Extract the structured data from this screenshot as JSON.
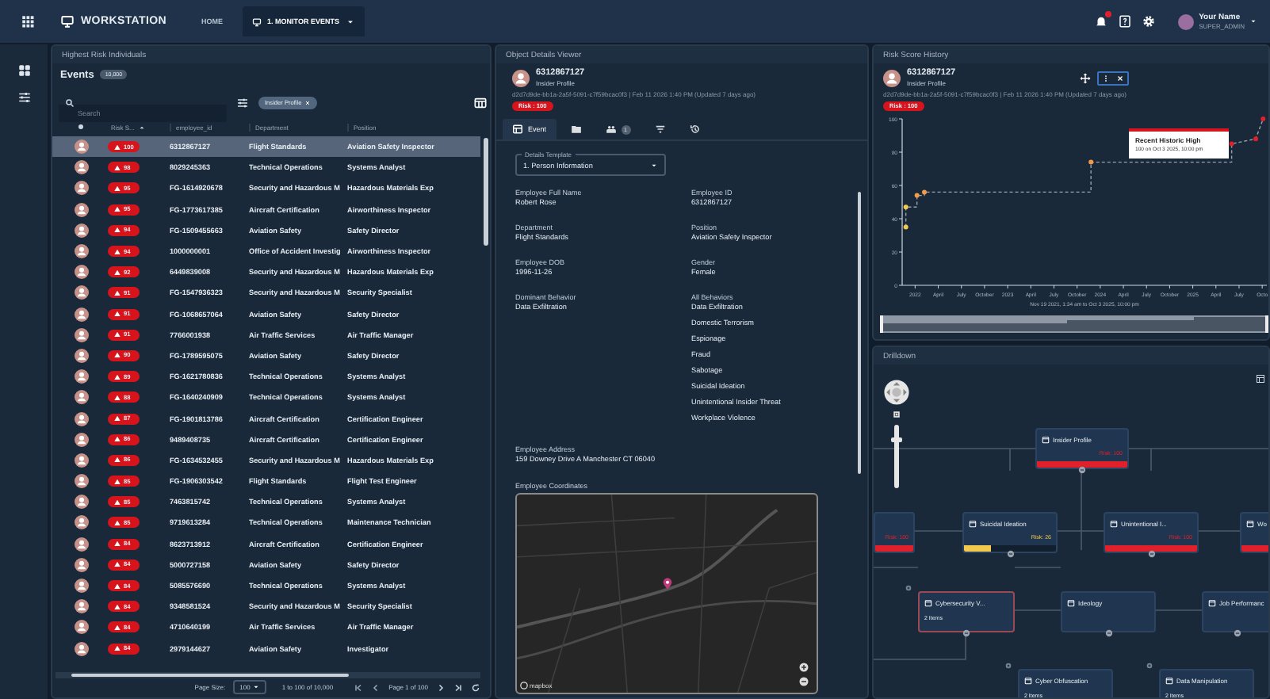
{
  "top_bar": {
    "app_title": "WORKSTATION",
    "nav": [
      {
        "label": "HOME",
        "selected": false
      },
      {
        "label": "1. MONITOR EVENTS",
        "selected": true
      }
    ],
    "user": {
      "name": "Your Name",
      "role": "SUPER_ADMIN"
    }
  },
  "events_panel": {
    "title": "Highest Risk Individuals",
    "heading": "Events",
    "count": "10,000",
    "search": {
      "placeholder": "Search"
    },
    "filters": [
      {
        "label": "Insider Profile"
      }
    ],
    "columns": [
      {
        "label": "Risk S...",
        "sorted": true
      },
      {
        "label": "employee_id",
        "sorted": false
      },
      {
        "label": "Department",
        "sorted": false
      },
      {
        "label": "Position",
        "sorted": false
      }
    ],
    "rows": [
      {
        "risk": "100",
        "employee_id": "6312867127",
        "department": "Flight Standards",
        "position": "Aviation Safety Inspector",
        "selected": true
      },
      {
        "risk": "98",
        "employee_id": "8029245363",
        "department": "Technical Operations",
        "position": "Systems Analyst",
        "selected": false
      },
      {
        "risk": "95",
        "employee_id": "FG-1614920678",
        "department": "Security and Hazardous M",
        "position": "Hazardous Materials Exp",
        "selected": false
      },
      {
        "risk": "95",
        "employee_id": "FG-1773617385",
        "department": "Aircraft Certification",
        "position": "Airworthiness Inspector",
        "selected": false
      },
      {
        "risk": "94",
        "employee_id": "FG-1509455663",
        "department": "Aviation Safety",
        "position": "Safety Director",
        "selected": false
      },
      {
        "risk": "94",
        "employee_id": "1000000001",
        "department": "Office of Accident Investig",
        "position": "Airworthiness Inspector",
        "selected": false
      },
      {
        "risk": "92",
        "employee_id": "6449839008",
        "department": "Security and Hazardous M",
        "position": "Hazardous Materials Exp",
        "selected": false
      },
      {
        "risk": "91",
        "employee_id": "FG-1547936323",
        "department": "Security and Hazardous M",
        "position": "Security Specialist",
        "selected": false
      },
      {
        "risk": "91",
        "employee_id": "FG-1068657064",
        "department": "Aviation Safety",
        "position": "Safety Director",
        "selected": false
      },
      {
        "risk": "91",
        "employee_id": "7766001938",
        "department": "Air Traffic Services",
        "position": "Air Traffic Manager",
        "selected": false
      },
      {
        "risk": "90",
        "employee_id": "FG-1789595075",
        "department": "Aviation Safety",
        "position": "Safety Director",
        "selected": false
      },
      {
        "risk": "89",
        "employee_id": "FG-1621780836",
        "department": "Technical Operations",
        "position": "Systems Analyst",
        "selected": false
      },
      {
        "risk": "88",
        "employee_id": "FG-1640240909",
        "department": "Technical Operations",
        "position": "Systems Analyst",
        "selected": false
      },
      {
        "risk": "87",
        "employee_id": "FG-1901813786",
        "department": "Aircraft Certification",
        "position": "Certification Engineer",
        "selected": false
      },
      {
        "risk": "86",
        "employee_id": "9489408735",
        "department": "Aircraft Certification",
        "position": "Certification Engineer",
        "selected": false
      },
      {
        "risk": "86",
        "employee_id": "FG-1634532455",
        "department": "Security and Hazardous M",
        "position": "Hazardous Materials Exp",
        "selected": false
      },
      {
        "risk": "85",
        "employee_id": "FG-1906303542",
        "department": "Flight Standards",
        "position": "Flight Test Engineer",
        "selected": false
      },
      {
        "risk": "85",
        "employee_id": "7463815742",
        "department": "Technical Operations",
        "position": "Systems Analyst",
        "selected": false
      },
      {
        "risk": "85",
        "employee_id": "9719613284",
        "department": "Technical Operations",
        "position": "Maintenance Technician",
        "selected": false
      },
      {
        "risk": "84",
        "employee_id": "8623713912",
        "department": "Aircraft Certification",
        "position": "Certification Engineer",
        "selected": false
      },
      {
        "risk": "84",
        "employee_id": "5000727158",
        "department": "Aviation Safety",
        "position": "Safety Director",
        "selected": false
      },
      {
        "risk": "84",
        "employee_id": "5085576690",
        "department": "Technical Operations",
        "position": "Systems Analyst",
        "selected": false
      },
      {
        "risk": "84",
        "employee_id": "9348581524",
        "department": "Security and Hazardous M",
        "position": "Security Specialist",
        "selected": false
      },
      {
        "risk": "84",
        "employee_id": "4710640199",
        "department": "Air Traffic Services",
        "position": "Air Traffic Manager",
        "selected": false
      },
      {
        "risk": "84",
        "employee_id": "2979144627",
        "department": "Aviation Safety",
        "position": "Investigator",
        "selected": false
      }
    ],
    "pagination": {
      "page_size_label": "Page Size:",
      "page_size": "100",
      "range": "1 to 100 of 10,000",
      "page": "Page 1 of 100"
    }
  },
  "details_panel": {
    "title": "Object Details Viewer",
    "record": {
      "id": "6312867127",
      "type": "Insider Profile",
      "meta": "d2d7d9de-bb1a-2a5f-5091-c7f59bcac0f3 | Feb 11 2026 1:40 PM (Updated 7 days ago)",
      "risk": "Risk : 100"
    },
    "tabs": [
      {
        "kind": "event",
        "label": "Event",
        "selected": true
      },
      {
        "kind": "folder",
        "selected": false
      },
      {
        "kind": "people",
        "badge": "1",
        "selected": false
      },
      {
        "kind": "filter",
        "selected": false
      },
      {
        "kind": "history",
        "selected": false
      }
    ],
    "template": {
      "label": "Details Template",
      "value": "1. Person Information"
    },
    "fields": [
      {
        "label": "Employee Full Name",
        "values": [
          "Robert Rose"
        ]
      },
      {
        "label": "Employee ID",
        "values": [
          "6312867127"
        ]
      },
      {
        "label": "Department",
        "values": [
          "Flight Standards"
        ]
      },
      {
        "label": "Position",
        "values": [
          "Aviation Safety Inspector"
        ]
      },
      {
        "label": "Employee DOB",
        "values": [
          "1996-11-26"
        ]
      },
      {
        "label": "Gender",
        "values": [
          "Female"
        ]
      },
      {
        "label": "Dominant Behavior",
        "values": [
          "Data Exfiltration"
        ]
      },
      {
        "label": "All Behaviors",
        "values": [
          "Data Exfiltration",
          "Domestic Terrorism",
          "Espionage",
          "Fraud",
          "Sabotage",
          "Suicidal Ideation",
          "Unintentional Insider Threat",
          "Workplace Violence"
        ]
      },
      {
        "label": "Employee Address",
        "values": [
          "159 Downey Drive A Manchester CT 06040"
        ]
      }
    ],
    "map": {
      "label": "Employee Coordinates",
      "attribution": "mapbox"
    }
  },
  "risk_history_panel": {
    "title": "Risk Score History",
    "record": {
      "id": "6312867127",
      "type": "Insider Profile",
      "meta": "d2d7d9de-bb1a-2a5f-5091-c7f59bcac0f3 | Feb 11 2026 1:40 PM (Updated 7 days ago)",
      "risk": "Risk : 100"
    },
    "tooltip": {
      "title": "Recent Historic High",
      "text": "100 on Oct 3 2025, 10:00 pm"
    },
    "chart_data": {
      "type": "line",
      "xlabel": "Nov 19 2021, 1:34 am to Oct 3 2025, 10:00 pm",
      "x": [
        2021.9,
        2021.9,
        2021.93,
        2022.02,
        2022.02,
        2022.1,
        2022.1,
        2022.62,
        2023.9,
        2023.9,
        2025.42,
        2025.42,
        2025.68,
        2025.76
      ],
      "series": [
        {
          "color": "#9aa3ad",
          "line_style": "dashed",
          "marker": "circle",
          "values": [
            35,
            47,
            47,
            47,
            54,
            54,
            56,
            56,
            56,
            74,
            74,
            85,
            88,
            100
          ]
        }
      ],
      "xlim": [
        2021.86,
        2025.8
      ],
      "ylim": [
        0,
        100
      ],
      "xticks": [
        {
          "value": 2022,
          "label": "2022"
        },
        {
          "value": 2022.25,
          "label": "April"
        },
        {
          "value": 2022.5,
          "label": "July"
        },
        {
          "value": 2022.75,
          "label": "October"
        },
        {
          "value": 2023,
          "label": "2023"
        },
        {
          "value": 2023.25,
          "label": "April"
        },
        {
          "value": 2023.5,
          "label": "July"
        },
        {
          "value": 2023.75,
          "label": "October"
        },
        {
          "value": 2024,
          "label": "2024"
        },
        {
          "value": 2024.25,
          "label": "April"
        },
        {
          "value": 2024.5,
          "label": "July"
        },
        {
          "value": 2024.75,
          "label": "October"
        },
        {
          "value": 2025,
          "label": "2025"
        },
        {
          "value": 2025.25,
          "label": "April"
        },
        {
          "value": 2025.5,
          "label": "July"
        },
        {
          "value": 2025.75,
          "label": "Octo"
        }
      ],
      "yticks": [
        0,
        20,
        40,
        60,
        80,
        100
      ]
    }
  },
  "drilldown_panel": {
    "title": "Drilldown",
    "zoom": {
      "level": 0.8
    },
    "nodes": [
      {
        "kind": "risk",
        "title": "Insider Profile",
        "risk": "Risk: 100",
        "level": 1,
        "color": "#e0202a",
        "selected": false
      },
      {
        "kind": "risk",
        "risk": "Risk: 100",
        "level": 1,
        "color": "#e0202a",
        "selected": false
      },
      {
        "kind": "risk",
        "title": "Suicidal Ideation",
        "risk": "Risk: 26",
        "level": 0.3,
        "color": "#f2c94c",
        "selected": false
      },
      {
        "kind": "risk",
        "title": "Unintentional I...",
        "risk": "Risk: 100",
        "level": 1,
        "color": "#e0202a",
        "selected": false
      },
      {
        "kind": "risk",
        "title": "Wo",
        "level": 1,
        "color": "#e0202a",
        "selected": false
      },
      {
        "kind": "group",
        "title": "Cybersecurity V...",
        "items": "2 Items",
        "selected": true
      },
      {
        "kind": "group",
        "title": "Ideology",
        "selected": false
      },
      {
        "kind": "group",
        "title": "Job Performanc",
        "selected": false
      },
      {
        "kind": "group",
        "title": "Cyber Obfuscation",
        "items": "2 Items",
        "selected": false
      },
      {
        "kind": "group",
        "title": "Data Manipulation",
        "items": "2 Items",
        "selected": false
      }
    ]
  }
}
